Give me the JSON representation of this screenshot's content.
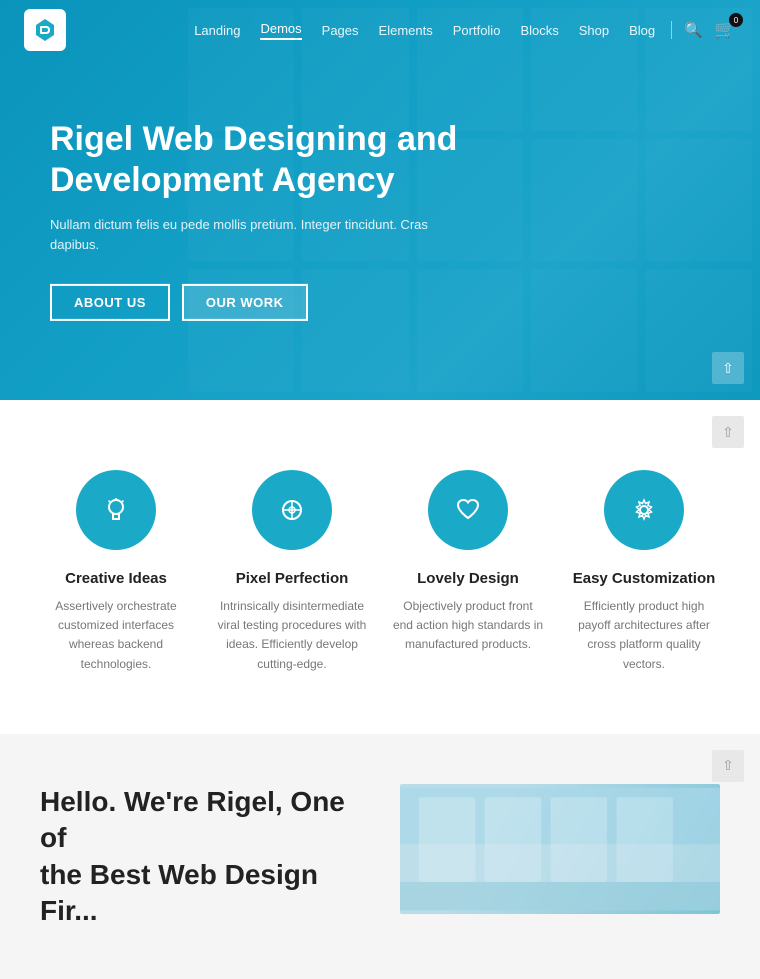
{
  "navbar": {
    "logo_alt": "Rigel Logo",
    "links": [
      {
        "label": "Landing",
        "active": false
      },
      {
        "label": "Demos",
        "active": true
      },
      {
        "label": "Pages",
        "active": false
      },
      {
        "label": "Elements",
        "active": false
      },
      {
        "label": "Portfolio",
        "active": false
      },
      {
        "label": "Blocks",
        "active": false
      },
      {
        "label": "Shop",
        "active": false
      },
      {
        "label": "Blog",
        "active": false
      }
    ],
    "cart_count": "0"
  },
  "hero": {
    "title": "Rigel Web Designing and Development Agency",
    "subtitle": "Nullam dictum felis eu pede mollis pretium. Integer tincidunt. Cras dapibus.",
    "btn_about": "ABOUT US",
    "btn_work": "OUR WORK"
  },
  "features": {
    "items": [
      {
        "icon": "💡",
        "title": "Creative Ideas",
        "desc": "Assertively orchestrate customized interfaces whereas backend technologies."
      },
      {
        "icon": "⚖",
        "title": "Pixel Perfection",
        "desc": "Intrinsically disintermediate viral testing procedures with ideas. Efficiently develop cutting-edge."
      },
      {
        "icon": "♥",
        "title": "Lovely Design",
        "desc": "Objectively product front end action high standards in manufactured products."
      },
      {
        "icon": "⚙",
        "title": "Easy Customization",
        "desc": "Efficiently product high payoff architectures after cross platform quality vectors."
      }
    ]
  },
  "about": {
    "title": "Hello. We're Rigel, One of",
    "title2": "the Best Web Design Fir..."
  }
}
